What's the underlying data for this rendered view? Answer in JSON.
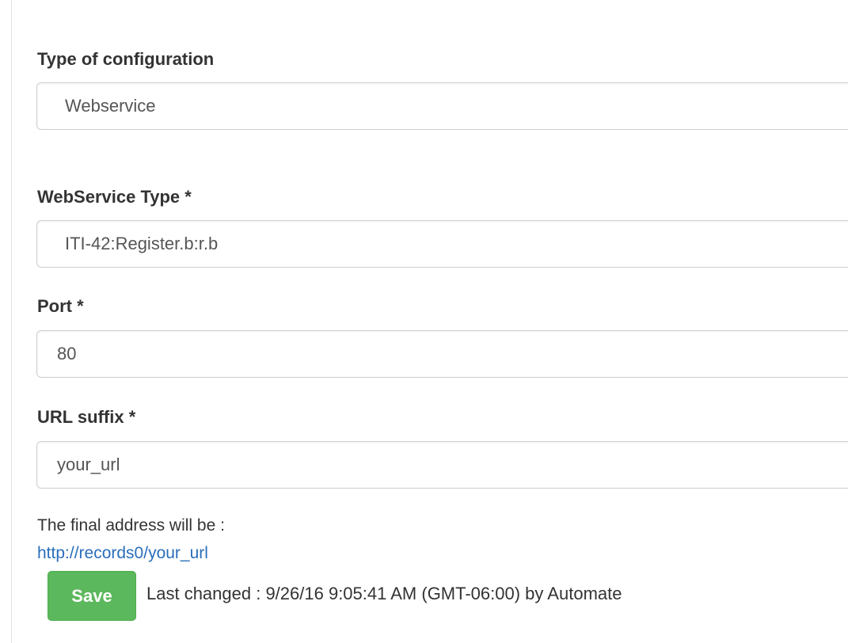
{
  "form": {
    "config_type": {
      "label": "Type of configuration",
      "value": "Webservice"
    },
    "webservice_type": {
      "label": "WebService Type *",
      "value": "ITI-42:Register.b:r.b"
    },
    "port": {
      "label": "Port *",
      "value": "80"
    },
    "url_suffix": {
      "label": "URL suffix *",
      "value": "your_url"
    },
    "final_address": {
      "label": "The final address will be :",
      "link": "http://records0/your_url"
    },
    "save_label": "Save",
    "last_changed": "Last changed : 9/26/16 9:05:41 AM (GMT-06:00) by Automate"
  },
  "colors": {
    "save_button": "#5cb85c",
    "link": "#2a6ebb"
  }
}
